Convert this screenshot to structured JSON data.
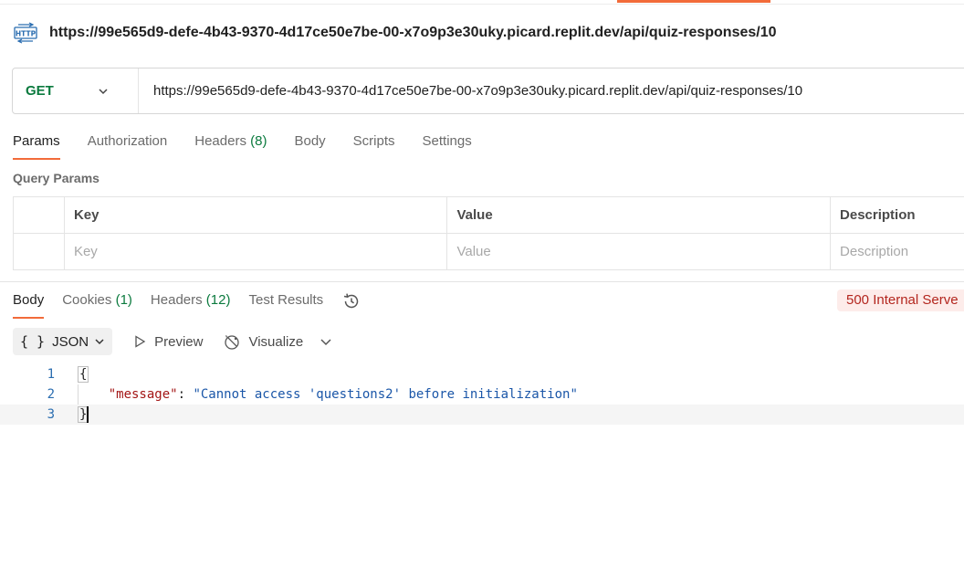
{
  "request": {
    "title": "https://99e565d9-defe-4b43-9370-4d17ce50e7be-00-x7o9p3e30uky.picard.replit.dev/api/quiz-responses/10",
    "icon": "http-icon",
    "method": "GET",
    "url": "https://99e565d9-defe-4b43-9370-4d17ce50e7be-00-x7o9p3e30uky.picard.replit.dev/api/quiz-responses/10"
  },
  "request_tabs": {
    "params": "Params",
    "authorization": "Authorization",
    "headers": "Headers",
    "headers_count": "(8)",
    "body": "Body",
    "scripts": "Scripts",
    "settings": "Settings"
  },
  "query_params": {
    "label": "Query Params",
    "columns": [
      "Key",
      "Value",
      "Description"
    ],
    "placeholders": [
      "Key",
      "Value",
      "Description"
    ]
  },
  "response_tabs": {
    "body": "Body",
    "cookies": "Cookies",
    "cookies_count": "(1)",
    "headers": "Headers",
    "headers_count": "(12)",
    "test_results": "Test Results"
  },
  "status": {
    "text": "500 Internal Serve",
    "color": "#b3261e"
  },
  "view": {
    "format": "JSON",
    "preview": "Preview",
    "visualize": "Visualize"
  },
  "response_body": {
    "line_numbers": [
      "1",
      "2",
      "3"
    ],
    "open_brace": "{",
    "key": "\"message\"",
    "colon": ": ",
    "value": "\"Cannot access 'questions2' before initialization\"",
    "close_brace": "}"
  },
  "colors": {
    "accent": "#f26b3a",
    "method_get": "#0b7a3e",
    "json_key": "#a31515",
    "json_string": "#1a56a8"
  }
}
